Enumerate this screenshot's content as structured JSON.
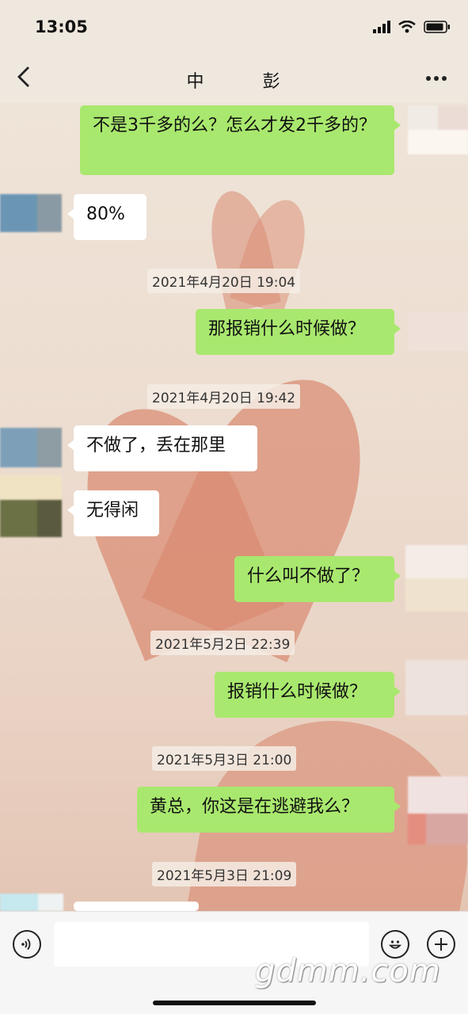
{
  "status_bar": {
    "time": "13:05"
  },
  "header": {
    "back_icon": "chevron-left-icon",
    "title": "中　　　彭",
    "more_icon": "more-dots-icon"
  },
  "messages": [
    {
      "side": "me",
      "text": "不是3千多的么？怎么才发2千多的？"
    },
    {
      "side": "other",
      "text": "80%"
    },
    {
      "type": "timestamp",
      "text": "2021年4月20日 19:04"
    },
    {
      "side": "me",
      "text": "那报销什么时候做？"
    },
    {
      "type": "timestamp",
      "text": "2021年4月20日 19:42"
    },
    {
      "side": "other",
      "text": "不做了，丢在那里"
    },
    {
      "side": "other",
      "text": "无得闲"
    },
    {
      "side": "me",
      "text": "什么叫不做了？"
    },
    {
      "type": "timestamp",
      "text": "2021年5月2日 22:39"
    },
    {
      "side": "me",
      "text": "报销什么时候做？"
    },
    {
      "type": "timestamp",
      "text": "2021年5月3日 21:00"
    },
    {
      "side": "me",
      "text": "黄总，你这是在逃避我么？"
    },
    {
      "type": "timestamp",
      "text": "2021年5月3日 21:09"
    },
    {
      "side": "other",
      "text": ""
    }
  ],
  "input_bar": {
    "voice_icon": "voice-icon",
    "emoji_icon": "emoji-icon",
    "plus_icon": "plus-icon",
    "input_value": ""
  },
  "watermark": "gdmm.com",
  "colors": {
    "me_bubble": "#a9e86e",
    "other_bubble": "#ffffff",
    "heart": "#d98b72"
  }
}
